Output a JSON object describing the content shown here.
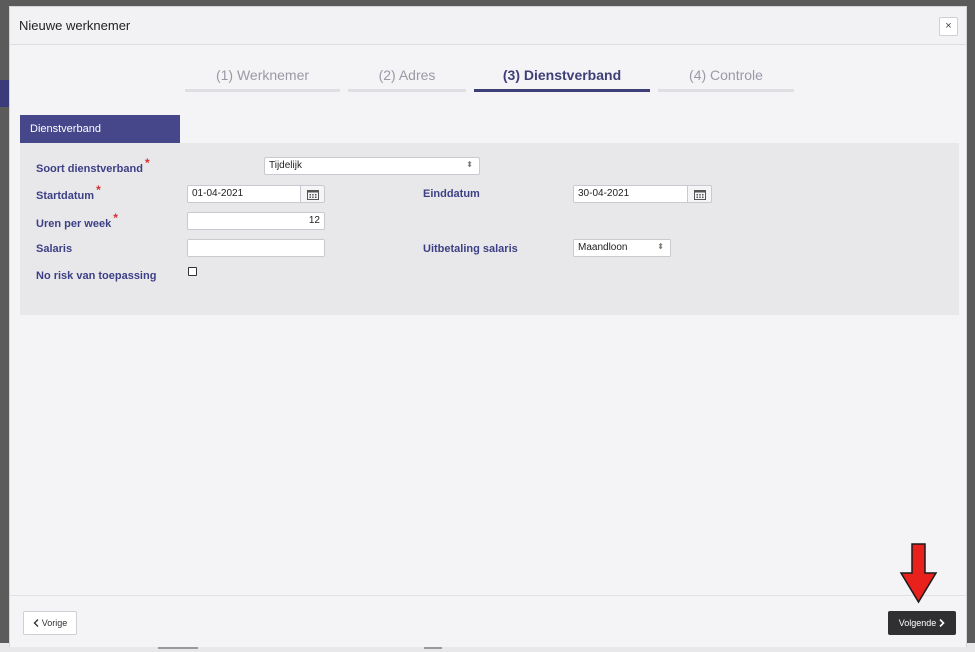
{
  "modal": {
    "title": "Nieuwe werknemer",
    "close_glyph": "×"
  },
  "steps": [
    {
      "label": "(1) Werknemer",
      "active": false
    },
    {
      "label": "(2) Adres",
      "active": false
    },
    {
      "label": "(3) Dienstverband",
      "active": true
    },
    {
      "label": "(4) Controle",
      "active": false
    }
  ],
  "section": {
    "tab_label": "Dienstverband"
  },
  "form": {
    "soort_dienstverband": {
      "label": "Soort dienstverband",
      "required_mark": "*",
      "value": "Tijdelijk"
    },
    "startdatum": {
      "label": "Startdatum",
      "required_mark": "*",
      "value": "01-04-2021"
    },
    "einddatum": {
      "label": "Einddatum",
      "value": "30-04-2021"
    },
    "uren_per_week": {
      "label": "Uren per week",
      "required_mark": "*",
      "value": "12"
    },
    "salaris": {
      "label": "Salaris",
      "value": ""
    },
    "uitbetaling_salaris": {
      "label": "Uitbetaling salaris",
      "value": "Maandloon"
    },
    "no_risk": {
      "label": "No risk van toepassing",
      "checked": false
    }
  },
  "footer": {
    "prev_label": "Vorige",
    "next_label": "Volgende"
  },
  "icons": {
    "select_arrow": "select-arrows-icon",
    "calendar": "calendar-icon",
    "prev": "chevron-left-icon",
    "next": "chevron-right-icon",
    "annotation": "red-arrow-down-icon"
  },
  "colors": {
    "accent": "#3e3f78",
    "required": "#d63030",
    "annotation_arrow": "#e8211c",
    "next_button": "#303033"
  }
}
